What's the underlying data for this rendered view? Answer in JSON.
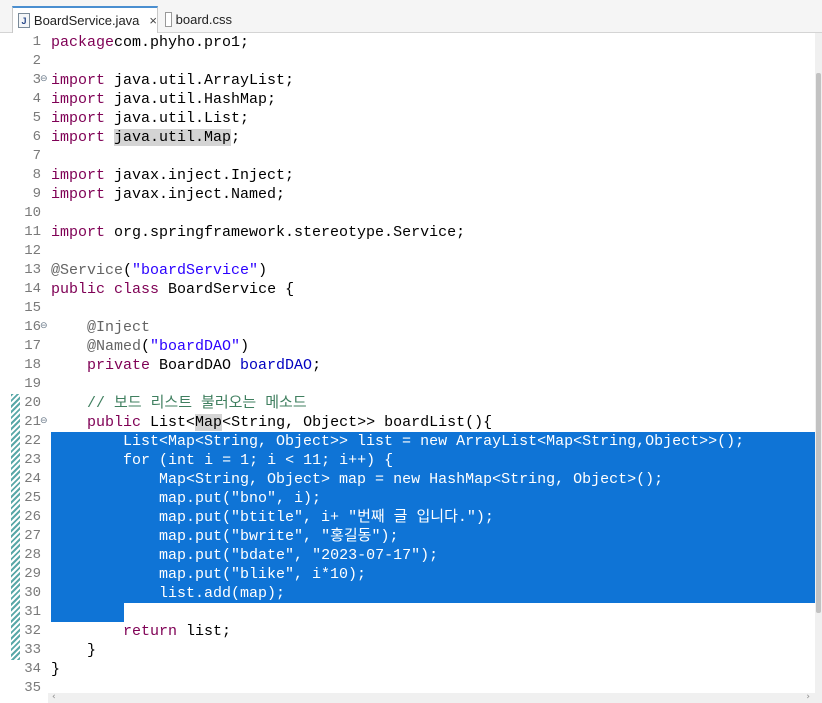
{
  "tabs": [
    {
      "label": "BoardService.java",
      "icon": "java-file-icon",
      "active": true,
      "close": "×"
    },
    {
      "label": "board.css",
      "icon": "css-file-icon",
      "active": false
    }
  ],
  "selected_lines": [
    22,
    31
  ],
  "lines": [
    {
      "n": "1",
      "t": [
        [
          "kw",
          "package"
        ],
        [
          "",
          "com.phyho.pro1;"
        ]
      ]
    },
    {
      "n": "2",
      "t": []
    },
    {
      "n": "3",
      "fold": "⊖",
      "t": [
        [
          "kw",
          "import"
        ],
        [
          "",
          " java.util.ArrayList;"
        ]
      ]
    },
    {
      "n": "4",
      "t": [
        [
          "kw",
          "import"
        ],
        [
          "",
          " java.util.HashMap;"
        ]
      ]
    },
    {
      "n": "5",
      "t": [
        [
          "kw",
          "import"
        ],
        [
          "",
          " java.util.List;"
        ]
      ]
    },
    {
      "n": "6",
      "t": [
        [
          "kw",
          "import"
        ],
        [
          "",
          " "
        ],
        [
          "hl",
          "java.util.Map"
        ],
        [
          "",
          ";"
        ]
      ]
    },
    {
      "n": "7",
      "t": []
    },
    {
      "n": "8",
      "t": [
        [
          "kw",
          "import"
        ],
        [
          "",
          " javax.inject.Inject;"
        ]
      ]
    },
    {
      "n": "9",
      "t": [
        [
          "kw",
          "import"
        ],
        [
          "",
          " javax.inject.Named;"
        ]
      ]
    },
    {
      "n": "10",
      "t": []
    },
    {
      "n": "11",
      "t": [
        [
          "kw",
          "import"
        ],
        [
          "",
          " org.springframework.stereotype.Service;"
        ]
      ]
    },
    {
      "n": "12",
      "t": []
    },
    {
      "n": "13",
      "t": [
        [
          "ann",
          "@Service"
        ],
        [
          "",
          "("
        ],
        [
          "str",
          "\"boardService\""
        ],
        [
          "",
          ")"
        ]
      ]
    },
    {
      "n": "14",
      "t": [
        [
          "kw",
          "public"
        ],
        [
          "",
          " "
        ],
        [
          "kw",
          "class"
        ],
        [
          "",
          " BoardService {"
        ]
      ]
    },
    {
      "n": "15",
      "t": []
    },
    {
      "n": "16",
      "fold": "⊖",
      "t": [
        [
          "",
          "    "
        ],
        [
          "ann",
          "@Inject"
        ]
      ]
    },
    {
      "n": "17",
      "t": [
        [
          "",
          "    "
        ],
        [
          "ann",
          "@Named"
        ],
        [
          "",
          "("
        ],
        [
          "str",
          "\"boardDAO\""
        ],
        [
          "",
          ")"
        ]
      ]
    },
    {
      "n": "18",
      "t": [
        [
          "",
          "    "
        ],
        [
          "kw",
          "private"
        ],
        [
          "",
          " BoardDAO "
        ],
        [
          "fld",
          "boardDAO"
        ],
        [
          "",
          ";"
        ]
      ]
    },
    {
      "n": "19",
      "t": []
    },
    {
      "n": "20",
      "t": [
        [
          "",
          "    "
        ],
        [
          "cmt",
          "// 보드 리스트 불러오는 메소드"
        ]
      ]
    },
    {
      "n": "21",
      "fold": "⊖",
      "t": [
        [
          "",
          "    "
        ],
        [
          "kw",
          "public"
        ],
        [
          "",
          " List<"
        ],
        [
          "hl",
          "Map"
        ],
        [
          "",
          "<String, Object>> boardList(){"
        ]
      ]
    },
    {
      "n": "22",
      "t": [
        [
          "",
          "        List<Map<String, Object>> list = "
        ],
        [
          "kw",
          "new"
        ],
        [
          "",
          " ArrayList<Map<String,Object>>();"
        ]
      ]
    },
    {
      "n": "23",
      "t": [
        [
          "",
          "        "
        ],
        [
          "kw",
          "for"
        ],
        [
          "",
          " ("
        ],
        [
          "kw",
          "int"
        ],
        [
          "",
          " i = 1; i < 11; i++) {"
        ]
      ]
    },
    {
      "n": "24",
      "t": [
        [
          "",
          "            Map<String, Object> map = "
        ],
        [
          "kw",
          "new"
        ],
        [
          "",
          " HashMap<String, Object>();"
        ]
      ]
    },
    {
      "n": "25",
      "t": [
        [
          "",
          "            map.put("
        ],
        [
          "str",
          "\"bno\""
        ],
        [
          "",
          ", i);"
        ]
      ]
    },
    {
      "n": "26",
      "t": [
        [
          "",
          "            map.put("
        ],
        [
          "str",
          "\"btitle\""
        ],
        [
          "",
          ", i+ "
        ],
        [
          "str",
          "\"번째 글 입니다.\""
        ],
        [
          "",
          ");"
        ]
      ]
    },
    {
      "n": "27",
      "t": [
        [
          "",
          "            map.put("
        ],
        [
          "str",
          "\"bwrite\""
        ],
        [
          "",
          ", "
        ],
        [
          "str",
          "\"홍길동\""
        ],
        [
          "",
          ");"
        ]
      ]
    },
    {
      "n": "28",
      "t": [
        [
          "",
          "            map.put("
        ],
        [
          "str",
          "\"bdate\""
        ],
        [
          "",
          ", "
        ],
        [
          "str",
          "\"2023-07-17\""
        ],
        [
          "",
          ");"
        ]
      ]
    },
    {
      "n": "29",
      "t": [
        [
          "",
          "            map.put("
        ],
        [
          "str",
          "\"blike\""
        ],
        [
          "",
          ", i*10);"
        ]
      ]
    },
    {
      "n": "30",
      "t": [
        [
          "",
          "            list.add(map);"
        ]
      ]
    },
    {
      "n": "31",
      "t": [
        [
          "",
          "        }"
        ]
      ]
    },
    {
      "n": "32",
      "t": [
        [
          "",
          "        "
        ],
        [
          "kw",
          "return"
        ],
        [
          "",
          " list;"
        ]
      ]
    },
    {
      "n": "33",
      "t": [
        [
          "",
          "    }"
        ]
      ]
    },
    {
      "n": "34",
      "t": [
        [
          "",
          "}"
        ]
      ]
    },
    {
      "n": "35",
      "t": []
    }
  ]
}
